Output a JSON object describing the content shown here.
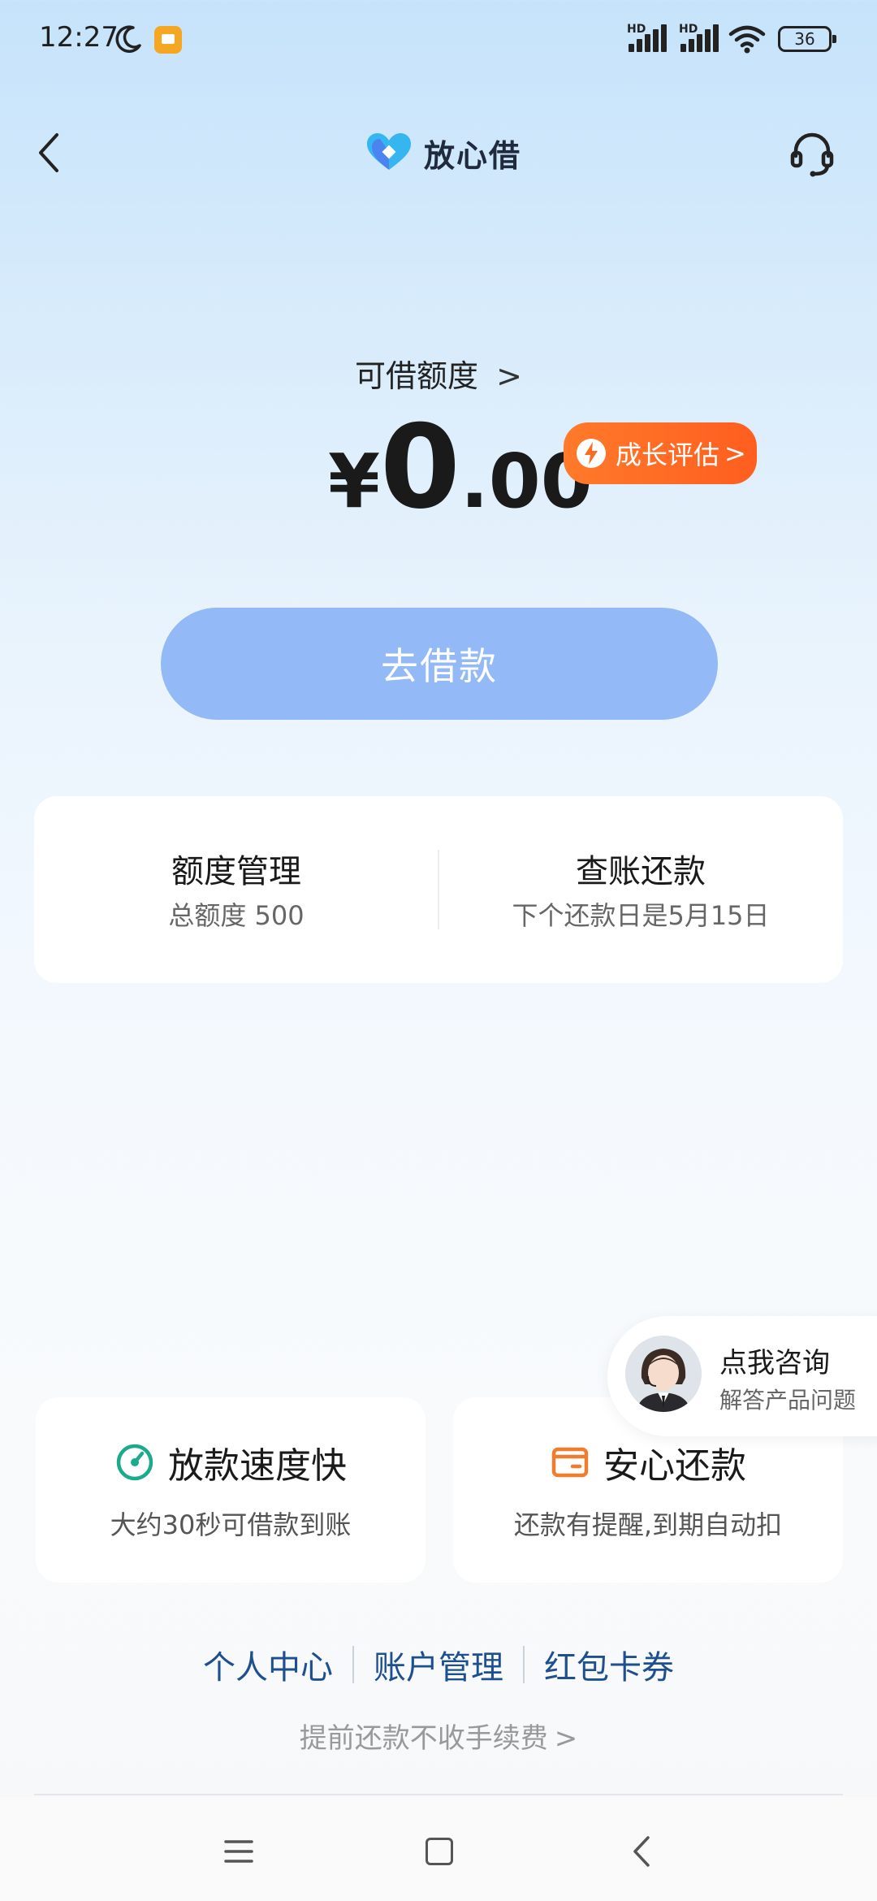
{
  "status_bar": {
    "time": "12:27",
    "battery": "36",
    "hd": "HD"
  },
  "header": {
    "title": "放心借"
  },
  "credit": {
    "label": "可借额度",
    "chevron": ">",
    "yen": "¥",
    "amount_int": "0",
    "amount_dec": ".00"
  },
  "growth_button": {
    "label": "成长评估",
    "chevron": ">"
  },
  "borrow_button": {
    "label": "去借款"
  },
  "info_card": {
    "left": {
      "title": "额度管理",
      "subtitle": "总额度 500"
    },
    "right": {
      "title": "查账还款",
      "subtitle": "下个还款日是5月15日"
    }
  },
  "consult": {
    "title": "点我咨询",
    "subtitle": "解答产品问题"
  },
  "features": [
    {
      "title": "放款速度快",
      "subtitle": "大约30秒可借款到账",
      "icon": "speed-icon",
      "color": "#1aaa8c"
    },
    {
      "title": "安心还款",
      "subtitle": "还款有提醒,到期自动扣",
      "icon": "wallet-icon",
      "color": "#f07c2e"
    }
  ],
  "links": [
    "个人中心",
    "账户管理",
    "红包卡券"
  ],
  "prepay": {
    "label": "提前还款不收手续费",
    "chevron": ">"
  },
  "colors": {
    "accent": "#93b9f7",
    "orange": "#ff6a22",
    "link": "#1e4f8e"
  }
}
